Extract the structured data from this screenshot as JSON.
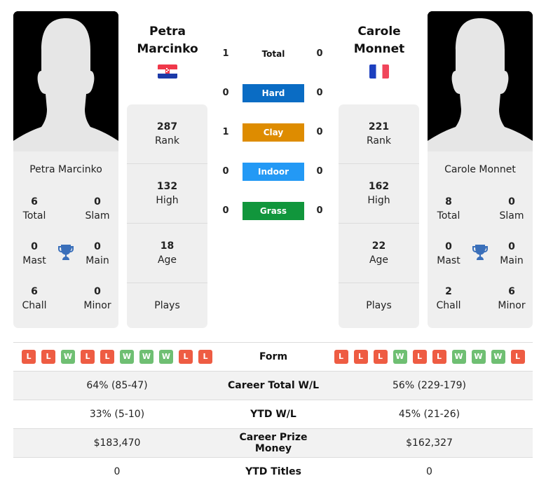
{
  "players": [
    {
      "name": "Petra Marcinko",
      "name_line1": "Petra",
      "name_line2": "Marcinko",
      "country_flag": "croatia-flag",
      "titles": {
        "total": "6",
        "total_label": "Total",
        "slam": "0",
        "slam_label": "Slam",
        "mast": "0",
        "mast_label": "Mast",
        "main": "0",
        "main_label": "Main",
        "chall": "6",
        "chall_label": "Chall",
        "minor": "0",
        "minor_label": "Minor"
      },
      "stats": {
        "rank": "287",
        "rank_label": "Rank",
        "high": "132",
        "high_label": "High",
        "age": "18",
        "age_label": "Age",
        "plays_label": "Plays"
      },
      "form": [
        "L",
        "L",
        "W",
        "L",
        "L",
        "W",
        "W",
        "W",
        "L",
        "L"
      ],
      "career_wl": "64% (85-47)",
      "ytd_wl": "33% (5-10)",
      "prize_money": "$183,470",
      "ytd_titles": "0"
    },
    {
      "name": "Carole Monnet",
      "name_line1": "Carole",
      "name_line2": "Monnet",
      "country_flag": "france-flag",
      "titles": {
        "total": "8",
        "total_label": "Total",
        "slam": "0",
        "slam_label": "Slam",
        "mast": "0",
        "mast_label": "Mast",
        "main": "0",
        "main_label": "Main",
        "chall": "2",
        "chall_label": "Chall",
        "minor": "6",
        "minor_label": "Minor"
      },
      "stats": {
        "rank": "221",
        "rank_label": "Rank",
        "high": "162",
        "high_label": "High",
        "age": "22",
        "age_label": "Age",
        "plays_label": "Plays"
      },
      "form": [
        "L",
        "L",
        "L",
        "W",
        "L",
        "L",
        "W",
        "W",
        "W",
        "L"
      ],
      "career_wl": "56% (229-179)",
      "ytd_wl": "45% (21-26)",
      "prize_money": "$162,327",
      "ytd_titles": "0"
    }
  ],
  "h2h": [
    {
      "label": "Total",
      "left": "1",
      "right": "0",
      "color": ""
    },
    {
      "label": "Hard",
      "left": "0",
      "right": "0",
      "color": "#0a6cc4"
    },
    {
      "label": "Clay",
      "left": "1",
      "right": "0",
      "color": "#de8c00"
    },
    {
      "label": "Indoor",
      "left": "0",
      "right": "0",
      "color": "#2399f5"
    },
    {
      "label": "Grass",
      "left": "0",
      "right": "0",
      "color": "#11963c"
    }
  ],
  "table": {
    "form_label": "Form",
    "career_wl_label": "Career Total W/L",
    "ytd_wl_label": "YTD W/L",
    "prize_label": "Career Prize Money",
    "ytd_titles_label": "YTD Titles"
  },
  "colors": {
    "loss": "#ee5c43",
    "win": "#6fbf73",
    "trophy": "#3a6fba"
  }
}
